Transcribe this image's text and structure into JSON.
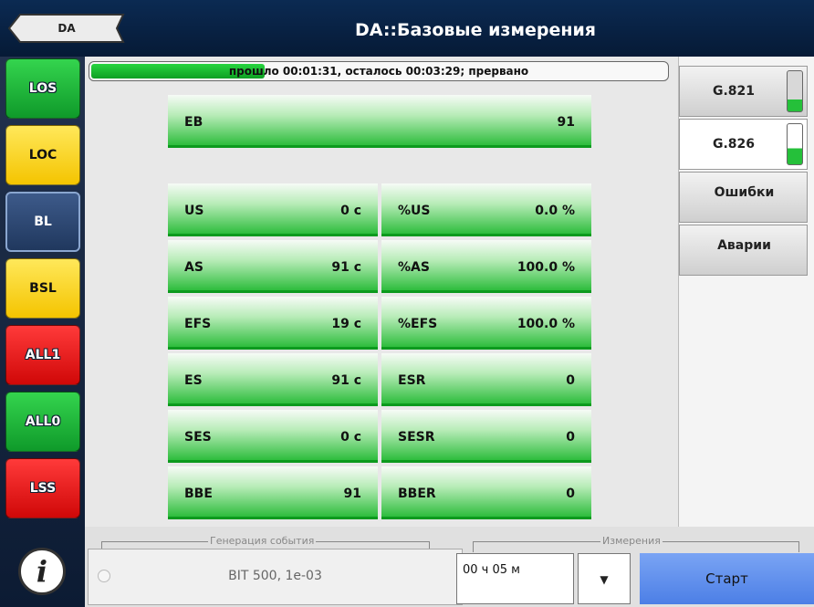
{
  "header": {
    "back_label": "DA",
    "title": "DA::Базовые измерения"
  },
  "sidebar": {
    "buttons": [
      {
        "label": "LOS",
        "color": "#1fbd39"
      },
      {
        "label": "LOC",
        "color": "#f7d21a"
      },
      {
        "label": "BL",
        "color": "#2c4670"
      },
      {
        "label": "BSL",
        "color": "#f7d21a"
      },
      {
        "label": "ALL1",
        "color": "#ee1414"
      },
      {
        "label": "ALL0",
        "color": "#1fbd39"
      },
      {
        "label": "LSS",
        "color": "#ee1414"
      }
    ],
    "info_glyph": "i"
  },
  "progress": {
    "text": "прошло 00:01:31, осталось 00:03:29; прервано",
    "fraction": 0.3
  },
  "eb": {
    "label": "EB",
    "value": "91"
  },
  "rows": [
    {
      "l_label": "US",
      "l_value": "0 с",
      "r_label": "%US",
      "r_value": "0.0 %"
    },
    {
      "l_label": "AS",
      "l_value": "91 с",
      "r_label": "%AS",
      "r_value": "100.0 %"
    },
    {
      "l_label": "EFS",
      "l_value": "19 с",
      "r_label": "%EFS",
      "r_value": "100.0 %"
    },
    {
      "l_label": "ES",
      "l_value": "91 с",
      "r_label": "ESR",
      "r_value": "0"
    },
    {
      "l_label": "SES",
      "l_value": "0 с",
      "r_label": "SESR",
      "r_value": "0"
    },
    {
      "l_label": "BBE",
      "l_value": "91",
      "r_label": "BBER",
      "r_value": "0"
    }
  ],
  "tabs": [
    {
      "label": "G.821",
      "active": false
    },
    {
      "label": "G.826",
      "active": true
    },
    {
      "label": "Ошибки"
    },
    {
      "label": "Аварии"
    }
  ],
  "bottom": {
    "event_group_title": "Генерация события",
    "event_text": "BIT  500, 1e-03",
    "meas_group_title": "Измерения",
    "duration_value": "00 ч 05 м",
    "dropdown_glyph": "▼",
    "start_label": "Старт"
  },
  "colors": {
    "accent_green": "#1fbd39",
    "header_bg": "#0b2a52",
    "start_button": "#5c8cec"
  }
}
